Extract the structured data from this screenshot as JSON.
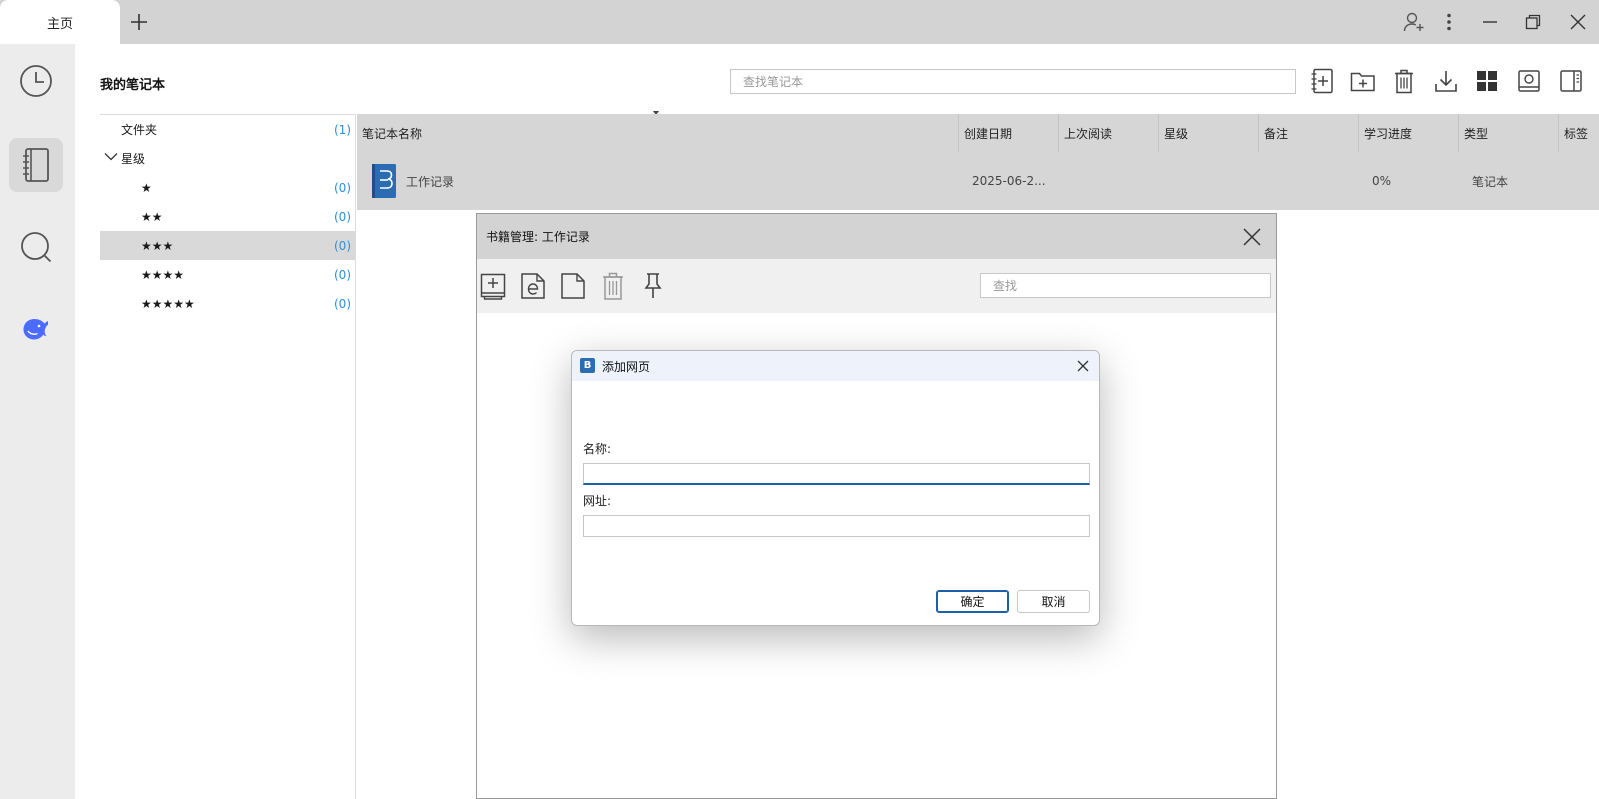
{
  "window": {
    "tab_home": "主页",
    "new_tab": "+"
  },
  "titlebar_icons": [
    "add-user-icon",
    "more-icon",
    "minimize-icon",
    "restore-icon",
    "close-icon"
  ],
  "rail": {
    "items": [
      "history-icon",
      "notebook-icon",
      "search-icon",
      "deepseek-icon"
    ],
    "active": "notebook-icon"
  },
  "header": {
    "title": "我的笔记本",
    "search_placeholder": "查找笔记本",
    "icons": [
      "new-notebook-icon",
      "new-folder-icon",
      "delete-icon",
      "import-icon",
      "grid-view-icon",
      "cover-view-icon",
      "sidebar-toggle-icon"
    ]
  },
  "tree": {
    "folders_label": "文件夹",
    "folders_count": "(1)",
    "stars_label": "星级",
    "stars": [
      {
        "label": "★",
        "count": "(0)"
      },
      {
        "label": "★★",
        "count": "(0)"
      },
      {
        "label": "★★★",
        "count": "(0)"
      },
      {
        "label": "★★★★",
        "count": "(0)"
      },
      {
        "label": "★★★★★",
        "count": "(0)"
      }
    ],
    "selected": "★★★"
  },
  "table": {
    "columns": [
      "笔记本名称",
      "创建日期",
      "上次阅读",
      "星级",
      "备注",
      "学习进度",
      "类型",
      "标签"
    ],
    "rows": [
      {
        "name": "工作记录",
        "created": "2025-06-2...",
        "last_read": "",
        "stars": "",
        "note": "",
        "progress": "0%",
        "type": "笔记本",
        "tags": ""
      }
    ]
  },
  "book_window": {
    "title": "书籍管理: 工作记录",
    "search_placeholder": "查找",
    "toolbar_icons": [
      "add-chapter-icon",
      "add-webpage-icon",
      "new-page-icon",
      "delete-icon",
      "pin-icon"
    ]
  },
  "dialog": {
    "title": "添加网页",
    "name_label": "名称:",
    "name_value": "",
    "url_label": "网址:",
    "url_value": "",
    "ok_label": "确定",
    "cancel_label": "取消"
  },
  "colors": {
    "accent": "#2c6cb3",
    "count_blue": "#2f8fd8",
    "deepseek_blue": "#4d6bfe",
    "selected_bg": "#d9d9d9"
  }
}
